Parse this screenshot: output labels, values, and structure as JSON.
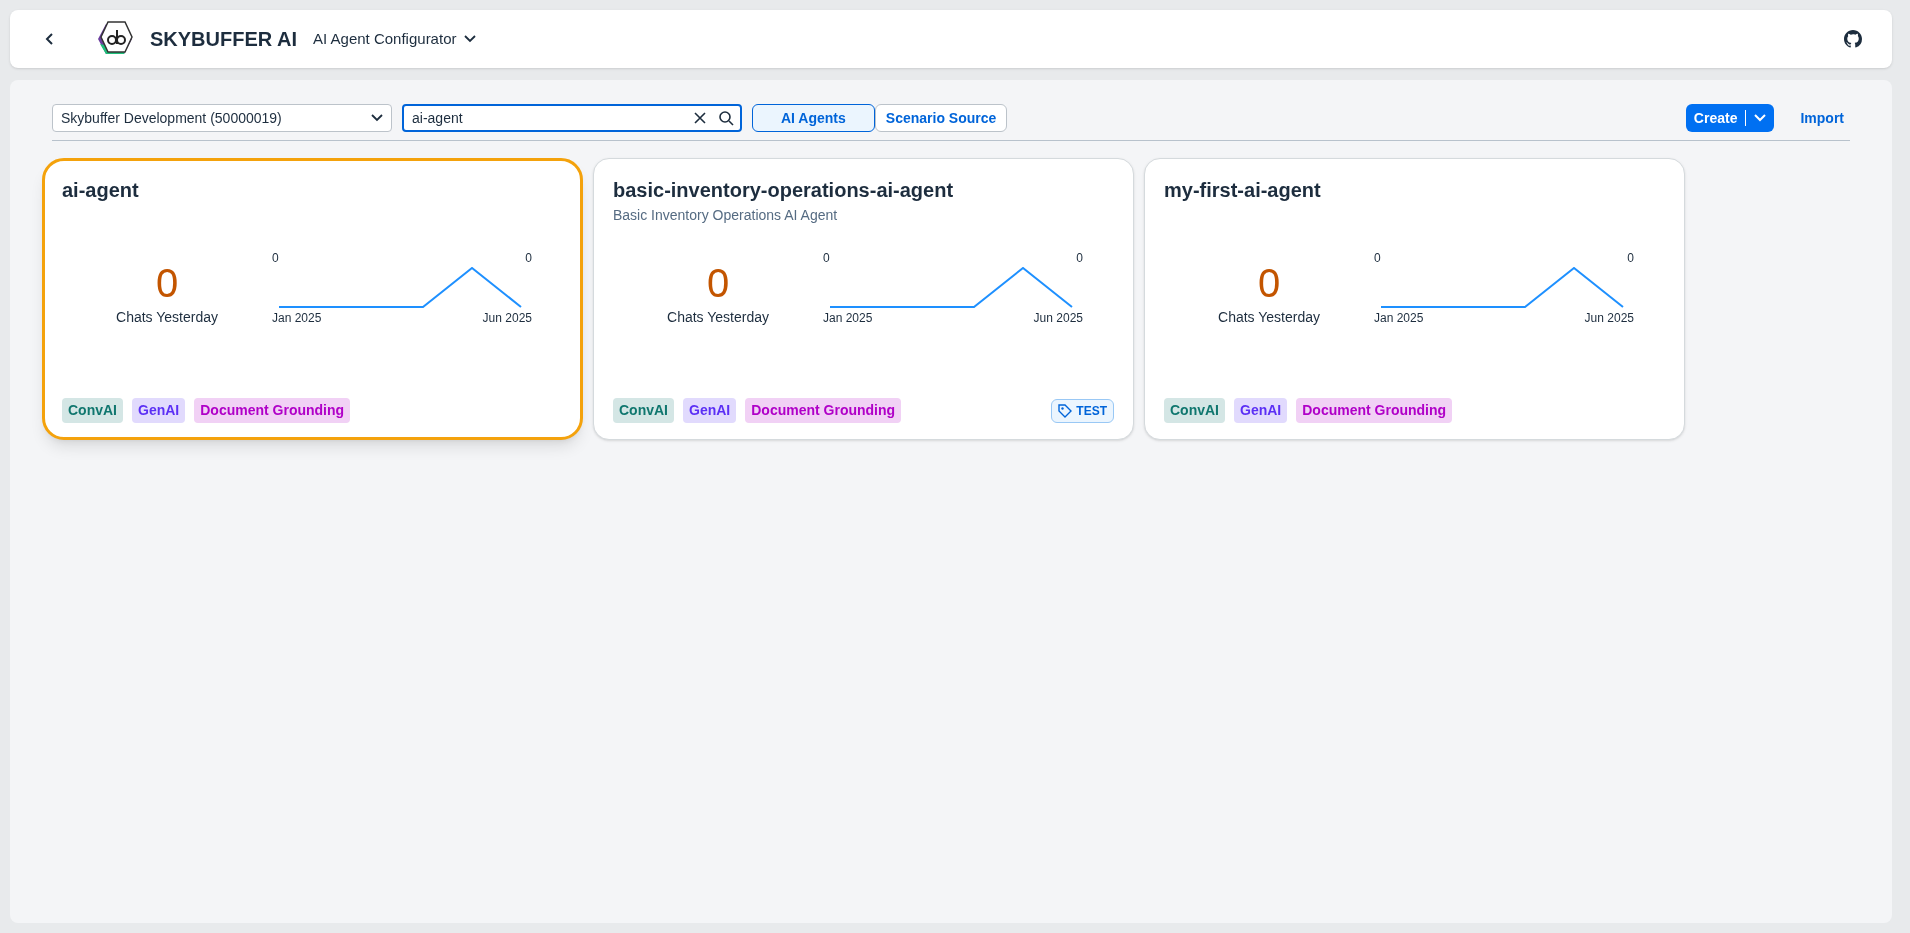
{
  "header": {
    "app_name": "SKYBUFFER AI",
    "app_switcher": "AI Agent Configurator"
  },
  "toolbar": {
    "system_select": {
      "value": "Skybuffer Development (50000019)"
    },
    "search": {
      "value": "ai-agent"
    },
    "view_tabs": [
      {
        "label": "AI Agents",
        "selected": true
      },
      {
        "label": "Scenario Source",
        "selected": false
      }
    ],
    "create_button": "Create",
    "import_link": "Import"
  },
  "cards": [
    {
      "title": "ai-agent",
      "selected": true,
      "metric": "0",
      "metric_label": "Chats Yesterday",
      "spark_start_value": "0",
      "spark_end_value": "0",
      "spark_start_label": "Jan 2025",
      "spark_end_label": "Jun 2025",
      "tags": [
        {
          "label": "ConvAI",
          "color": "#0f766e"
        },
        {
          "label": "GenAI",
          "color": "#5b2ff5"
        },
        {
          "label": "Document Grounding",
          "color": "#b000c8"
        }
      ]
    },
    {
      "title": "basic-inventory-operations-ai-agent",
      "subtitle": "Basic Inventory Operations AI Agent",
      "selected": false,
      "metric": "0",
      "metric_label": "Chats Yesterday",
      "spark_start_value": "0",
      "spark_end_value": "0",
      "spark_start_label": "Jan 2025",
      "spark_end_label": "Jun 2025",
      "tags": [
        {
          "label": "ConvAI",
          "color": "#0f766e"
        },
        {
          "label": "GenAI",
          "color": "#5b2ff5"
        },
        {
          "label": "Document Grounding",
          "color": "#b000c8"
        }
      ],
      "badge": "TEST"
    },
    {
      "title": "my-first-ai-agent",
      "selected": false,
      "metric": "0",
      "metric_label": "Chats Yesterday",
      "spark_start_value": "0",
      "spark_end_value": "0",
      "spark_start_label": "Jan 2025",
      "spark_end_label": "Jun 2025",
      "tags": [
        {
          "label": "ConvAI",
          "color": "#0f766e"
        },
        {
          "label": "GenAI",
          "color": "#5b2ff5"
        },
        {
          "label": "Document Grounding",
          "color": "#b000c8"
        }
      ]
    }
  ]
}
